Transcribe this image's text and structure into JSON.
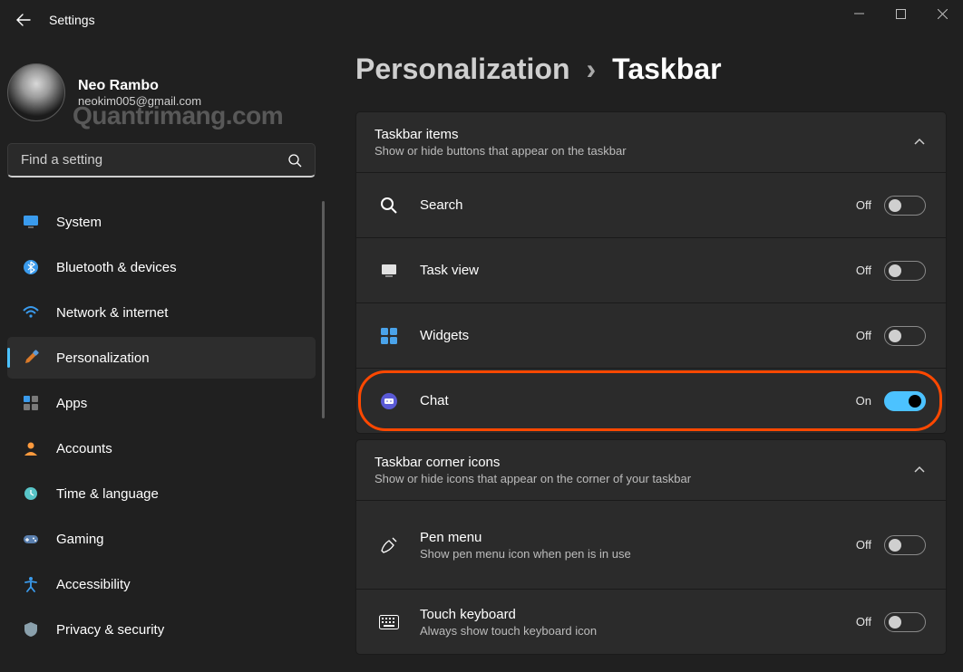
{
  "window": {
    "title": "Settings"
  },
  "user": {
    "name": "Neo Rambo",
    "email": "neokim005@gmail.com",
    "watermark": "Quantrimang.com"
  },
  "search": {
    "placeholder": "Find a setting"
  },
  "nav": [
    {
      "icon": "monitor-icon",
      "label": "System",
      "color": "#3a9bed"
    },
    {
      "icon": "bluetooth-icon",
      "label": "Bluetooth & devices",
      "color": "#3a9bed"
    },
    {
      "icon": "wifi-icon",
      "label": "Network & internet",
      "color": "#3a9bed"
    },
    {
      "icon": "brush-icon",
      "label": "Personalization",
      "color": "#3a9bed",
      "active": true
    },
    {
      "icon": "apps-icon",
      "label": "Apps",
      "color": "#3a9bed"
    },
    {
      "icon": "person-icon",
      "label": "Accounts",
      "color": "#ff9a3d"
    },
    {
      "icon": "clock-globe-icon",
      "label": "Time & language",
      "color": "#58c5c8"
    },
    {
      "icon": "gamepad-icon",
      "label": "Gaming",
      "color": "#5a7fae"
    },
    {
      "icon": "accessibility-icon",
      "label": "Accessibility",
      "color": "#3a9bed"
    },
    {
      "icon": "shield-icon",
      "label": "Privacy & security",
      "color": "#8aa0ac"
    }
  ],
  "breadcrumb": {
    "parent": "Personalization",
    "current": "Taskbar"
  },
  "sections": [
    {
      "title": "Taskbar items",
      "desc": "Show or hide buttons that appear on the taskbar",
      "rows": [
        {
          "icon": "search-icon",
          "title": "Search",
          "state": "Off",
          "on": false
        },
        {
          "icon": "taskview-icon",
          "title": "Task view",
          "state": "Off",
          "on": false
        },
        {
          "icon": "widgets-icon",
          "title": "Widgets",
          "state": "Off",
          "on": false
        },
        {
          "icon": "chat-icon",
          "title": "Chat",
          "state": "On",
          "on": true,
          "highlight": true
        }
      ]
    },
    {
      "title": "Taskbar corner icons",
      "desc": "Show or hide icons that appear on the corner of your taskbar",
      "rows": [
        {
          "icon": "pen-icon",
          "title": "Pen menu",
          "desc": "Show pen menu icon when pen is in use",
          "state": "Off",
          "on": false,
          "tall": true
        },
        {
          "icon": "keyboard-icon",
          "title": "Touch keyboard",
          "desc": "Always show touch keyboard icon",
          "state": "Off",
          "on": false
        }
      ]
    }
  ]
}
